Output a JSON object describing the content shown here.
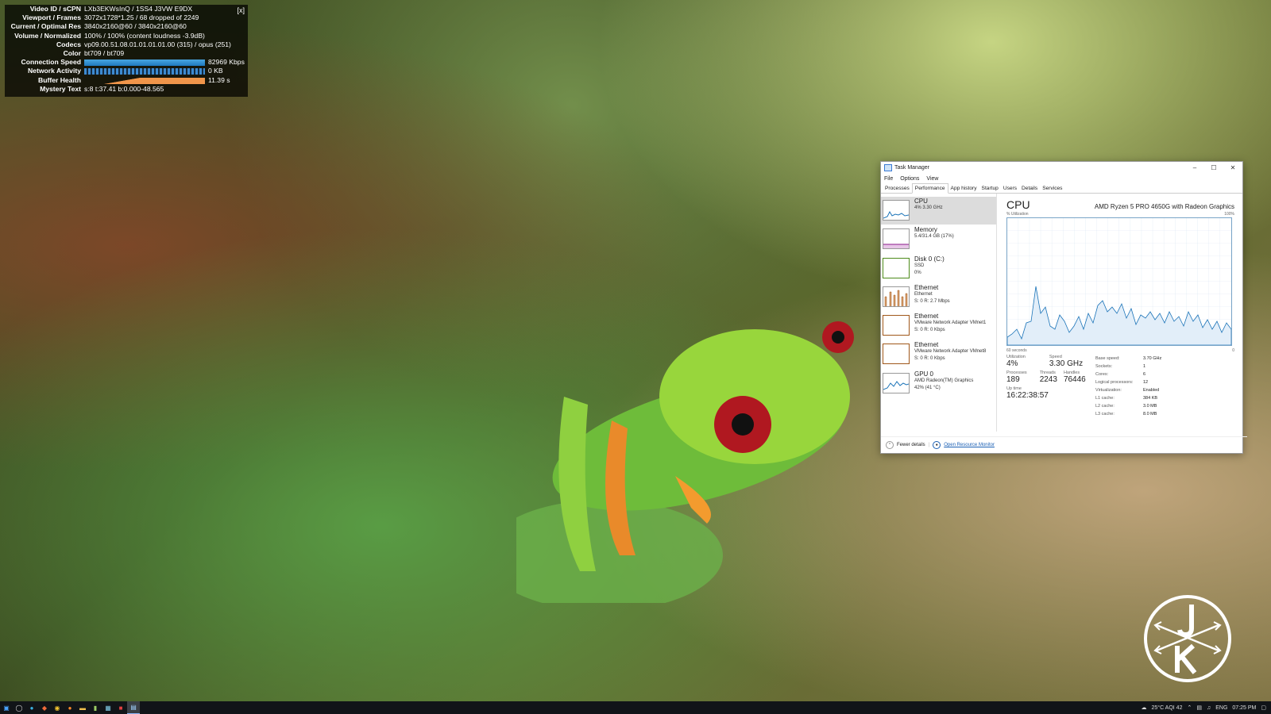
{
  "stats_overlay": {
    "close_label": "[x]",
    "rows": [
      {
        "label": "Video ID / sCPN",
        "value": "LXb3EKWsInQ / 1SS4 J3VW E9DX"
      },
      {
        "label": "Viewport / Frames",
        "value": "3072x1728*1.25 / 68 dropped of 2249"
      },
      {
        "label": "Current / Optimal Res",
        "value": "3840x2160@60 / 3840x2160@60"
      },
      {
        "label": "Volume / Normalized",
        "value": "100% / 100% (content loudness -3.9dB)"
      },
      {
        "label": "Codecs",
        "value": "vp09.00.51.08.01.01.01.01.00 (315) / opus (251)"
      },
      {
        "label": "Color",
        "value": "bt709 / bt709"
      },
      {
        "label": "Connection Speed",
        "value": "82969 Kbps"
      },
      {
        "label": "Network Activity",
        "value": "0 KB"
      },
      {
        "label": "Buffer Health",
        "value": "11.39 s"
      },
      {
        "label": "Mystery Text",
        "value": "s:8 t:37.41 b:0.000-48.565"
      }
    ]
  },
  "task_manager": {
    "title": "Task Manager",
    "menu": [
      "File",
      "Options",
      "View"
    ],
    "tabs": [
      "Processes",
      "Performance",
      "App history",
      "Startup",
      "Users",
      "Details",
      "Services"
    ],
    "active_tab": "Performance",
    "sidebar": [
      {
        "title": "CPU",
        "sub1": "4% 3.30 GHz",
        "sub2": "",
        "sub3": "",
        "color": "#1a73b8"
      },
      {
        "title": "Memory",
        "sub1": "5.4/31.4 GB (17%)",
        "sub2": "",
        "sub3": "",
        "color": "#8b1a8b"
      },
      {
        "title": "Disk 0 (C:)",
        "sub1": "SSD",
        "sub2": "0%",
        "sub3": "",
        "color": "#4d8b1a"
      },
      {
        "title": "Ethernet",
        "sub1": "Ethernet",
        "sub2": "S: 0 R: 2.7 Mbps",
        "sub3": "",
        "color": "#a0571a"
      },
      {
        "title": "Ethernet",
        "sub1": "VMware Network Adapter VMnet1",
        "sub2": "S: 0 R: 0 Kbps",
        "sub3": "",
        "color": "#a0571a"
      },
      {
        "title": "Ethernet",
        "sub1": "VMware Network Adapter VMnet8",
        "sub2": "S: 0 R: 0 Kbps",
        "sub3": "",
        "color": "#a0571a"
      },
      {
        "title": "GPU 0",
        "sub1": "AMD Radeon(TM) Graphics",
        "sub2": "42% (41 °C)",
        "sub3": "",
        "color": "#1a73b8"
      }
    ],
    "cpu": {
      "title": "CPU",
      "model": "AMD Ryzen 5 PRO 4650G with Radeon Graphics",
      "graph_top_left": "% Utilization",
      "graph_top_right": "100%",
      "graph_bottom_left": "60 seconds",
      "graph_bottom_right": "0",
      "utilization_label": "Utilization",
      "utilization": "4%",
      "speed_label": "Speed",
      "speed": "3.30 GHz",
      "processes_label": "Processes",
      "processes": "189",
      "threads_label": "Threads",
      "threads": "2243",
      "handles_label": "Handles",
      "handles": "76446",
      "uptime_label": "Up time",
      "uptime": "16:22:38:57",
      "specs": [
        {
          "k": "Base speed:",
          "v": "3.70 GHz"
        },
        {
          "k": "Sockets:",
          "v": "1"
        },
        {
          "k": "Cores:",
          "v": "6"
        },
        {
          "k": "Logical processors:",
          "v": "12"
        },
        {
          "k": "Virtualization:",
          "v": "Enabled"
        },
        {
          "k": "L1 cache:",
          "v": "384 KB"
        },
        {
          "k": "L2 cache:",
          "v": "3.0 MB"
        },
        {
          "k": "L3 cache:",
          "v": "8.0 MB"
        }
      ]
    },
    "footer": {
      "fewer": "Fewer details",
      "monitor": "Open Resource Monitor"
    }
  },
  "taskbar": {
    "weather": "25°C AQI 42",
    "lang": "ENG",
    "time": "07:25 PM"
  }
}
